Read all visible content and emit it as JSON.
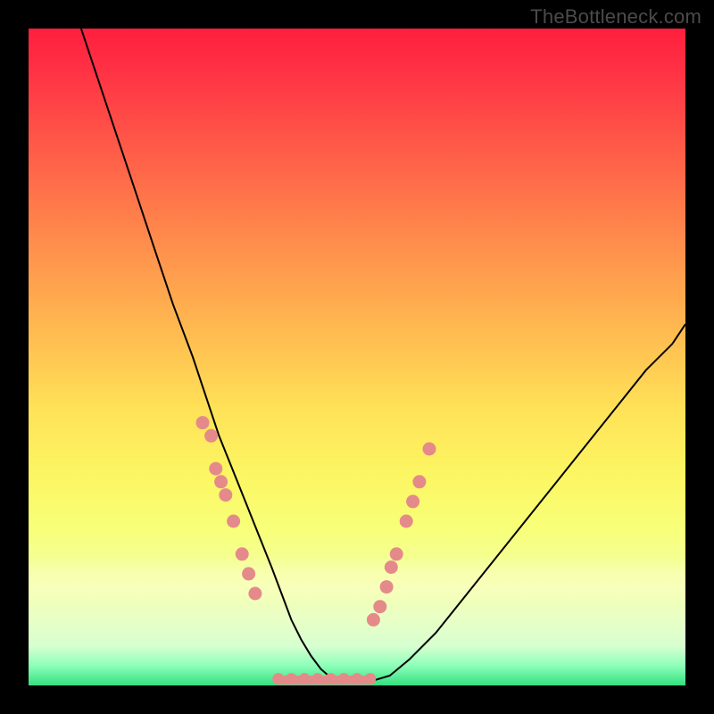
{
  "attribution": "TheBottleneck.com",
  "colors": {
    "frame": "#000000",
    "dot": "#e58a8a",
    "curve": "#000000"
  },
  "chart_data": {
    "type": "line",
    "title": "",
    "xlabel": "",
    "ylabel": "",
    "xlim": [
      0,
      100
    ],
    "ylim": [
      0,
      100
    ],
    "series": [
      {
        "name": "bottleneck-curve",
        "x": [
          8,
          10,
          13,
          16,
          19,
          22,
          25,
          27,
          29,
          31,
          33,
          35,
          37,
          38.5,
          40,
          41.5,
          43,
          44.5,
          46,
          49,
          52,
          55,
          58,
          62,
          66,
          70,
          74,
          78,
          82,
          86,
          90,
          94,
          98,
          100
        ],
        "y": [
          100,
          94,
          85,
          76,
          67,
          58,
          50,
          44,
          38,
          33,
          28,
          23,
          18,
          14,
          10,
          7,
          4.5,
          2.5,
          1.2,
          0.5,
          0.6,
          1.5,
          4,
          8,
          13,
          18,
          23,
          28,
          33,
          38,
          43,
          48,
          52,
          55
        ]
      }
    ],
    "points": [
      {
        "name": "left-cluster",
        "x": [
          26.5,
          27.8,
          28.5,
          29.3,
          30.0,
          31.2,
          32.5,
          33.5,
          34.5
        ],
        "y": [
          40,
          38,
          33,
          31,
          29,
          25,
          20,
          17,
          14
        ]
      },
      {
        "name": "right-cluster",
        "x": [
          52.5,
          53.5,
          54.5,
          55.2,
          56.0,
          57.5,
          58.5,
          59.5,
          61.0
        ],
        "y": [
          10,
          12,
          15,
          18,
          20,
          25,
          28,
          31,
          36
        ]
      },
      {
        "name": "bottom-run",
        "x": [
          38,
          40,
          42,
          44,
          46,
          48,
          50,
          52
        ],
        "y": [
          1,
          1,
          1,
          1,
          1,
          1,
          1,
          1
        ]
      }
    ],
    "flat_segment": {
      "x0": 38,
      "x1": 52,
      "y": 0.8
    }
  }
}
